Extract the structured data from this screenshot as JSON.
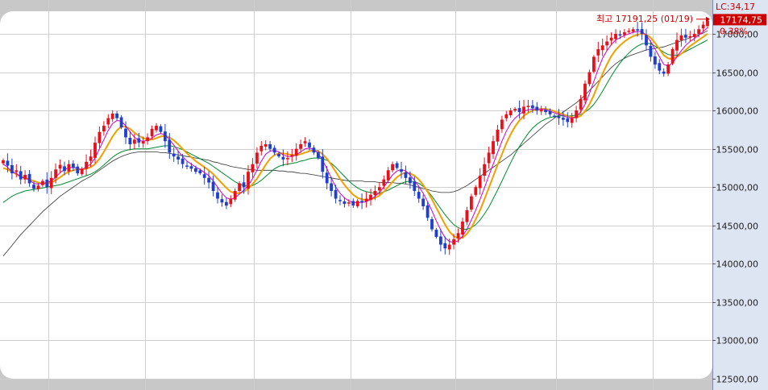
{
  "chart_data": {
    "type": "candlestick",
    "y_axis": {
      "min": 12500,
      "max": 17500,
      "ticks": [
        17000,
        16500,
        16000,
        15500,
        15000,
        14500,
        14000,
        13500,
        13000,
        12500
      ],
      "tick_labels": [
        "17000,00",
        "16500,00",
        "16000,00",
        "15500,00",
        "15000,00",
        "14500,00",
        "14000,00",
        "13500,00",
        "13000,00",
        "12500,00"
      ]
    },
    "grid": true,
    "annotations": {
      "indicator": "LC:34,17",
      "high_label": "최고 17191,25 (01/19)",
      "high_value": 17191.25,
      "last_price_label": "17174,75",
      "last_price": 17174.75,
      "change_pct": "0,38%"
    },
    "colors": {
      "up": "#e8101a",
      "down": "#1f3fd0",
      "ma_short": "#cc00cc",
      "ma_mid": "#f0a000",
      "ma_long": "#008a2e",
      "ma_longest": "#333333",
      "price_tag": "#cc0000",
      "axis_bg": "#dde4f2"
    },
    "close": [
      15350,
      15280,
      15180,
      15220,
      15100,
      15160,
      15050,
      14980,
      15020,
      15080,
      15000,
      15120,
      15230,
      15290,
      15210,
      15300,
      15250,
      15180,
      15240,
      15330,
      15400,
      15580,
      15720,
      15800,
      15900,
      15960,
      15900,
      15780,
      15650,
      15560,
      15620,
      15580,
      15600,
      15650,
      15760,
      15800,
      15720,
      15600,
      15450,
      15400,
      15360,
      15300,
      15280,
      15240,
      15200,
      15180,
      15120,
      15060,
      14950,
      14850,
      14800,
      14760,
      14850,
      14950,
      15050,
      15000,
      15200,
      15300,
      15450,
      15540,
      15560,
      15500,
      15450,
      15400,
      15360,
      15380,
      15420,
      15500,
      15560,
      15600,
      15520,
      15450,
      15380,
      15200,
      15050,
      14950,
      14850,
      14820,
      14780,
      14800,
      14760,
      14820,
      14800,
      14850,
      14900,
      14950,
      15000,
      15100,
      15220,
      15300,
      15250,
      15200,
      15120,
      15050,
      14950,
      14850,
      14750,
      14600,
      14450,
      14350,
      14250,
      14200,
      14250,
      14320,
      14400,
      14550,
      14700,
      14880,
      15000,
      15150,
      15300,
      15450,
      15600,
      15750,
      15880,
      15950,
      16000,
      16020,
      15980,
      16050,
      16060,
      16030,
      16000,
      16010,
      15980,
      15950,
      15930,
      15900,
      15880,
      15850,
      15900,
      16000,
      16150,
      16350,
      16500,
      16700,
      16800,
      16850,
      16900,
      16950,
      17000,
      16980,
      17020,
      17040,
      17060,
      17050,
      17000,
      16850,
      16700,
      16600,
      16520,
      16480,
      16600,
      16800,
      16920,
      16980,
      16950,
      16970,
      17000,
      17060,
      17120,
      17174.75
    ],
    "ma_short": [
      15300,
      15260,
      15200,
      15180,
      15130,
      15120,
      15090,
      15050,
      15040,
      15050,
      15060,
      15080,
      15130,
      15190,
      15230,
      15250,
      15260,
      15240,
      15230,
      15260,
      15300,
      15380,
      15500,
      15620,
      15740,
      15830,
      15870,
      15860,
      15800,
      15720,
      15650,
      15610,
      15600,
      15610,
      15640,
      15680,
      15700,
      15680,
      15620,
      15550,
      15470,
      15400,
      15340,
      15300,
      15260,
      15230,
      15190,
      15150,
      15080,
      15000,
      14920,
      14860,
      14840,
      14860,
      14910,
      14960,
      15020,
      15110,
      15220,
      15340,
      15430,
      15470,
      15480,
      15460,
      15420,
      15400,
      15400,
      15420,
      15460,
      15500,
      15510,
      15490,
      15440,
      15350,
      15240,
      15120,
      15000,
      14920,
      14860,
      14820,
      14800,
      14800,
      14800,
      14810,
      14840,
      14880,
      14930,
      15000,
      15080,
      15160,
      15210,
      15230,
      15210,
      15160,
      15090,
      15010,
      14920,
      14810,
      14690,
      14560,
      14440,
      14340,
      14290,
      14280,
      14300,
      14360,
      14450,
      14570,
      14700,
      14840,
      14990,
      15150,
      15300,
      15450,
      15600,
      15730,
      15830,
      15900,
      15950,
      15990,
      16010,
      16020,
      16020,
      16020,
      16010,
      15990,
      15970,
      15950,
      15930,
      15910,
      15900,
      15920,
      15980,
      16080,
      16220,
      16380,
      16540,
      16680,
      16780,
      16860,
      16920,
      16950,
      16980,
      17000,
      17020,
      17030,
      17030,
      16980,
      16900,
      16800,
      16700,
      16600,
      16580,
      16620,
      16700,
      16780,
      16850,
      16900,
      16940,
      16980,
      17030,
      17080
    ],
    "ma_mid": [
      15250,
      15230,
      15200,
      15170,
      15140,
      15120,
      15100,
      15080,
      15060,
      15050,
      15050,
      15060,
      15090,
      15130,
      15170,
      15200,
      15220,
      15230,
      15230,
      15240,
      15260,
      15300,
      15370,
      15460,
      15560,
      15660,
      15740,
      15790,
      15790,
      15760,
      15710,
      15670,
      15640,
      15620,
      15620,
      15640,
      15660,
      15670,
      15650,
      15610,
      15560,
      15500,
      15440,
      15390,
      15340,
      15300,
      15260,
      15220,
      15170,
      15110,
      15050,
      14990,
      14940,
      14920,
      14920,
      14940,
      14980,
      15040,
      15110,
      15200,
      15290,
      15370,
      15420,
      15440,
      15440,
      15430,
      15420,
      15420,
      15430,
      15450,
      15470,
      15480,
      15470,
      15430,
      15370,
      15290,
      15200,
      15110,
      15030,
      14960,
      14900,
      14860,
      14840,
      14830,
      14840,
      14860,
      14890,
      14940,
      15000,
      15070,
      15130,
      15170,
      15190,
      15180,
      15150,
      15100,
      15030,
      14940,
      14840,
      14730,
      14620,
      14510,
      14420,
      14360,
      14330,
      14340,
      14390,
      14470,
      14580,
      14700,
      14840,
      14990,
      15140,
      15290,
      15430,
      15570,
      15690,
      15790,
      15870,
      15930,
      15970,
      16000,
      16010,
      16020,
      16020,
      16010,
      15990,
      15970,
      15950,
      15930,
      15910,
      15910,
      15930,
      15990,
      16080,
      16200,
      16340,
      16480,
      16600,
      16710,
      16790,
      16850,
      16900,
      16940,
      16970,
      16990,
      17000,
      16990,
      16950,
      16880,
      16800,
      16720,
      16680,
      16670,
      16700,
      16740,
      16790,
      16840,
      16880,
      16920,
      16960,
      17000
    ],
    "ma_long": [
      14800,
      14840,
      14880,
      14910,
      14930,
      14950,
      14960,
      14970,
      14980,
      14990,
      15000,
      15010,
      15020,
      15030,
      15050,
      15070,
      15090,
      15110,
      15130,
      15150,
      15170,
      15200,
      15240,
      15290,
      15340,
      15390,
      15430,
      15460,
      15480,
      15490,
      15500,
      15500,
      15500,
      15500,
      15510,
      15520,
      15530,
      15540,
      15540,
      15530,
      15510,
      15490,
      15460,
      15430,
      15400,
      15370,
      15340,
      15310,
      15270,
      15230,
      15190,
      15150,
      15110,
      15070,
      15040,
      15020,
      15010,
      15020,
      15050,
      15090,
      15140,
      15190,
      15240,
      15270,
      15290,
      15300,
      15310,
      15320,
      15340,
      15350,
      15370,
      15380,
      15380,
      15370,
      15350,
      15310,
      15260,
      15200,
      15140,
      15080,
      15030,
      14990,
      14960,
      14940,
      14930,
      14920,
      14920,
      14940,
      14960,
      14990,
      15020,
      15050,
      15070,
      15080,
      15070,
      15050,
      15010,
      14950,
      14880,
      14800,
      14720,
      14640,
      14570,
      14510,
      14470,
      14450,
      14450,
      14470,
      14510,
      14570,
      14650,
      14740,
      14850,
      14960,
      15080,
      15200,
      15320,
      15430,
      15530,
      15620,
      15700,
      15770,
      15820,
      15860,
      15890,
      15910,
      15920,
      15930,
      15930,
      15930,
      15930,
      15940,
      15950,
      15980,
      16020,
      16080,
      16160,
      16250,
      16350,
      16450,
      16540,
      16620,
      16690,
      16750,
      16800,
      16840,
      16870,
      16880,
      16870,
      16840,
      16800,
      16760,
      16730,
      16720,
      16720,
      16740,
      16770,
      16800,
      16830,
      16860,
      16890,
      16920
    ],
    "ma_longest": [
      14100,
      14170,
      14240,
      14310,
      14380,
      14440,
      14500,
      14560,
      14620,
      14680,
      14730,
      14780,
      14830,
      14880,
      14920,
      14960,
      15000,
      15040,
      15080,
      15110,
      15140,
      15180,
      15220,
      15260,
      15300,
      15340,
      15370,
      15400,
      15420,
      15440,
      15450,
      15460,
      15460,
      15460,
      15460,
      15460,
      15450,
      15450,
      15440,
      15430,
      15420,
      15410,
      15400,
      15390,
      15380,
      15370,
      15360,
      15350,
      15330,
      15320,
      15300,
      15290,
      15270,
      15260,
      15250,
      15240,
      15230,
      15230,
      15220,
      15220,
      15220,
      15220,
      15220,
      15210,
      15210,
      15200,
      15200,
      15190,
      15180,
      15180,
      15170,
      15160,
      15150,
      15140,
      15130,
      15120,
      15110,
      15100,
      15090,
      15080,
      15080,
      15080,
      15080,
      15070,
      15070,
      15070,
      15060,
      15060,
      15060,
      15060,
      15050,
      15050,
      15040,
      15030,
      15010,
      15000,
      14980,
      14970,
      14950,
      14940,
      14930,
      14930,
      14930,
      14940,
      14960,
      14990,
      15020,
      15060,
      15100,
      15140,
      15180,
      15220,
      15260,
      15300,
      15340,
      15380,
      15420,
      15470,
      15520,
      15570,
      15620,
      15670,
      15720,
      15770,
      15820,
      15860,
      15900,
      15940,
      15980,
      16020,
      16060,
      16100,
      16150,
      16200,
      16260,
      16320,
      16380,
      16440,
      16500,
      16560,
      16610,
      16650,
      16680,
      16710,
      16730,
      16750,
      16770,
      16790,
      16800,
      16810,
      16820,
      16830,
      16850,
      16870,
      16890,
      16910,
      16930,
      16950,
      16970,
      16990,
      17010,
      17040
    ]
  }
}
